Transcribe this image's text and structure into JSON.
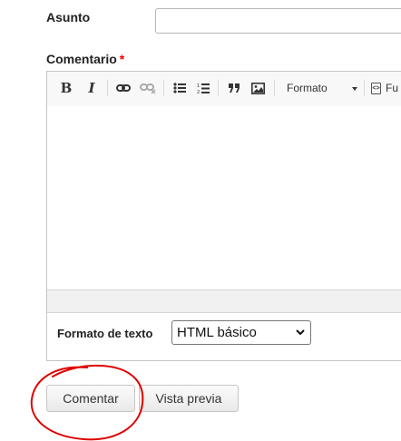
{
  "subject": {
    "label": "Asunto",
    "value": ""
  },
  "comment": {
    "label": "Comentario",
    "required_marker": "*"
  },
  "toolbar": {
    "bold_label": "B",
    "italic_label": "I",
    "format_label": "Formato",
    "source_label": "Fu",
    "icons": [
      "bold-icon",
      "italic-icon",
      "link-icon",
      "unlink-icon",
      "bulleted-list-icon",
      "numbered-list-icon",
      "blockquote-icon",
      "image-icon",
      "format-dropdown",
      "source-icon"
    ]
  },
  "text_format": {
    "label": "Formato de texto",
    "selected": "HTML básico"
  },
  "buttons": {
    "submit_label": "Comentar",
    "preview_label": "Vista previa"
  },
  "colors": {
    "required": "#ee0000",
    "annotation": "#e00000"
  }
}
